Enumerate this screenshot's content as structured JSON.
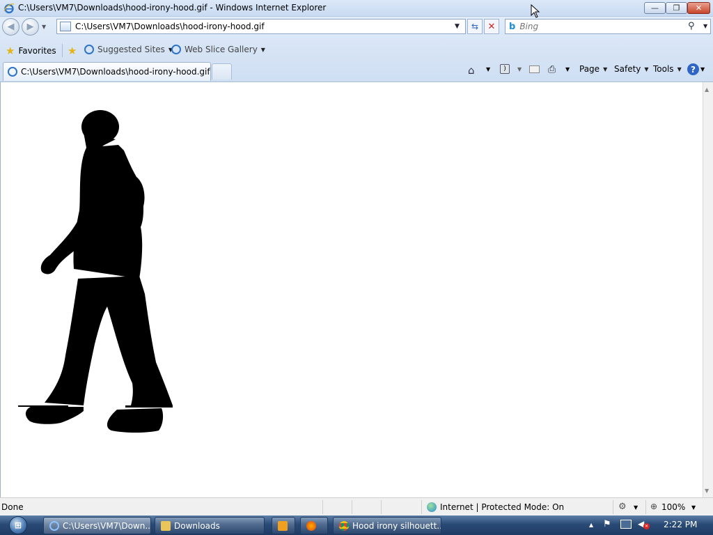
{
  "window": {
    "title": "C:\\Users\\VM7\\Downloads\\hood-irony-hood.gif - Windows Internet Explorer",
    "minimize_label": "—",
    "maximize_label": "❐",
    "close_label": "✕"
  },
  "nav": {
    "address": "C:\\Users\\VM7\\Downloads\\hood-irony-hood.gif",
    "search_placeholder": "Bing"
  },
  "favorites_bar": {
    "favorites_label": "Favorites",
    "suggested_label": "Suggested Sites",
    "webslice_label": "Web Slice Gallery"
  },
  "tabs": [
    {
      "label": "C:\\Users\\VM7\\Downloads\\hood-irony-hood.gif"
    }
  ],
  "command_bar": {
    "page_label": "Page",
    "safety_label": "Safety",
    "tools_label": "Tools",
    "help_label": "?"
  },
  "status": {
    "left_text": "Done",
    "zone_text": "Internet | Protected Mode: On",
    "zoom_text": "100%"
  },
  "taskbar": {
    "items": [
      {
        "label": "C:\\Users\\VM7\\Down..."
      },
      {
        "label": "Downloads"
      },
      {
        "label": ""
      },
      {
        "label": ""
      },
      {
        "label": "Hood irony silhouett..."
      }
    ],
    "clock": "2:22 PM"
  }
}
